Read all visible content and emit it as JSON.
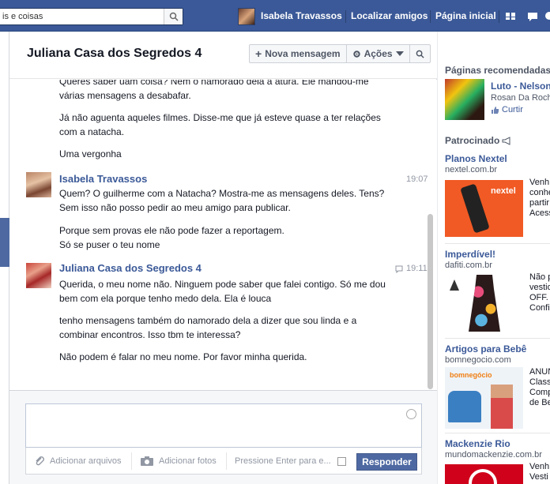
{
  "topbar": {
    "search_text": "is e coisas",
    "user_name": "Isabela Travassos",
    "find_friends": "Localizar amigos",
    "home": "Página inicial"
  },
  "conversation": {
    "title": "Juliana Casa dos Segredos 4",
    "new_message_label": "Nova mensagem",
    "actions_label": "Ações",
    "messages": [
      {
        "text": "Queres saber uam coisa? Nem o namorado dela a atura. Ele mandou-me várias mensagens a desabafar."
      },
      {
        "text": "Já não aguenta aqueles filmes. Disse-me que já esteve quase a ter relações com a natacha."
      },
      {
        "text": "Uma vergonha"
      },
      {
        "author": "Isabela Travassos",
        "time": "19:07",
        "text": "Quem? O guilherme com a Natacha? Mostra-me as mensagens deles. Tens? Sem isso não posso pedir ao meu amigo para publicar."
      },
      {
        "text": "Porque sem provas ele não pode fazer a reportagem."
      },
      {
        "text": "Só se puser o teu nome"
      },
      {
        "author": "Juliana Casa dos Segredos 4",
        "time": "19:11",
        "text": "Querida, o meu nome não. Ninguem pode saber que falei contigo. Só me dou bem com ela porque tenho medo dela. Ela é louca"
      },
      {
        "text": "tenho mensagens também do namorado dela a dizer que sou linda e a combinar encontros. Isso tbm te interessa?"
      },
      {
        "text": "Não podem é falar no meu nome. Por favor minha querida."
      }
    ],
    "composer": {
      "attach_files": "Adicionar arquivos",
      "attach_photos": "Adicionar fotos",
      "press_enter": "Pressione Enter para e...",
      "reply_label": "Responder"
    }
  },
  "sidebar": {
    "recommended_heading": "Páginas recomendadas",
    "page_name": "Luto - Nelson",
    "page_sub": "Rosan Da Rocha",
    "like_label": "Curtir",
    "sponsored_heading": "Patrocinado",
    "ads": [
      {
        "title": "Planos Nextel",
        "domain": "nextel.com.br",
        "img_text": "nextel",
        "lines": [
          "Venh",
          "conhe",
          "partir",
          "Acess"
        ]
      },
      {
        "title": "Imperdível!",
        "domain": "dafiti.com.br",
        "lines": [
          "Não p",
          "vestid",
          "OFF.",
          "Confir"
        ]
      },
      {
        "title": "Artigos para Bebê",
        "domain": "bomnegocio.com",
        "img_text": "bomnegócio",
        "lines": [
          "ANUN",
          "Classi",
          "Comp",
          "de Be"
        ]
      },
      {
        "title": "Mackenzie Rio",
        "domain": "mundomackenzie.com.br",
        "lines": [
          "Venh",
          "Vesti"
        ]
      }
    ]
  },
  "colors": {
    "brand": "#3b5998",
    "button": "#4e69a2",
    "nextel": "#f15a24"
  }
}
